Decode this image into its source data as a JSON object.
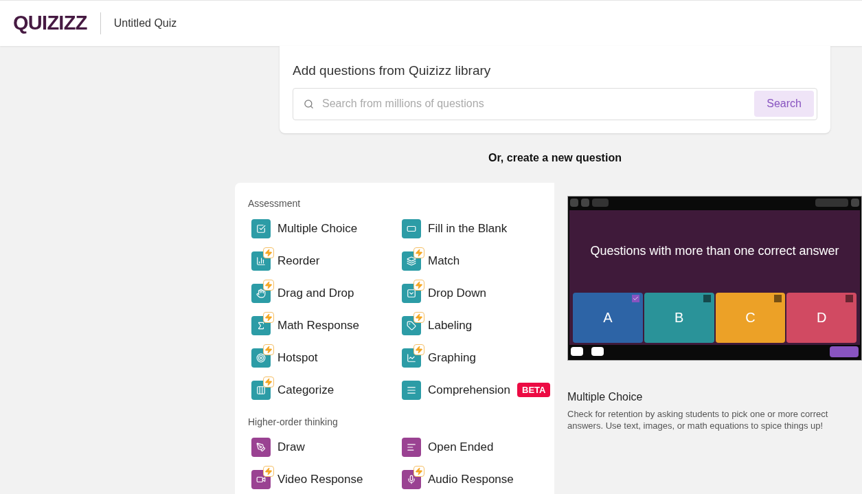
{
  "header": {
    "logo": "QUIZIZZ",
    "title": "Untitled Quiz"
  },
  "library": {
    "heading": "Add questions from Quizizz library",
    "search": {
      "placeholder": "Search from millions of questions"
    },
    "button": "Search"
  },
  "create_heading": "Or, create a new question",
  "sections": [
    {
      "title": "Assessment",
      "color": "#2c9ca6",
      "items": [
        {
          "label": "Multiple Choice",
          "new": false
        },
        {
          "label": "Fill in the Blank",
          "new": false
        },
        {
          "label": "Reorder",
          "new": true
        },
        {
          "label": "Match",
          "new": true
        },
        {
          "label": "Drag and Drop",
          "new": true
        },
        {
          "label": "Drop Down",
          "new": true
        },
        {
          "label": "Math Response",
          "new": true
        },
        {
          "label": "Labeling",
          "new": true
        },
        {
          "label": "Hotspot",
          "new": true
        },
        {
          "label": "Graphing",
          "new": true
        },
        {
          "label": "Categorize",
          "new": true
        },
        {
          "label": "Comprehension",
          "new": false,
          "tag": "BETA"
        }
      ]
    },
    {
      "title": "Higher-order thinking",
      "color": "#9a4292",
      "items": [
        {
          "label": "Draw",
          "new": false
        },
        {
          "label": "Open Ended",
          "new": false
        },
        {
          "label": "Video Response",
          "new": true
        },
        {
          "label": "Audio Response",
          "new": true
        }
      ]
    }
  ],
  "preview": {
    "question": "Questions with more than one correct answer",
    "options": [
      {
        "letter": "A",
        "color": "#2d64a6",
        "checked": true
      },
      {
        "letter": "B",
        "color": "#2a9399",
        "checked": false
      },
      {
        "letter": "C",
        "color": "#eca127",
        "checked": false
      },
      {
        "letter": "D",
        "color": "#d14a62",
        "checked": false
      }
    ],
    "title": "Multiple Choice",
    "description": "Check for retention by asking students to pick one or more correct answers. Use text, images, or math equations to spice things up!"
  }
}
